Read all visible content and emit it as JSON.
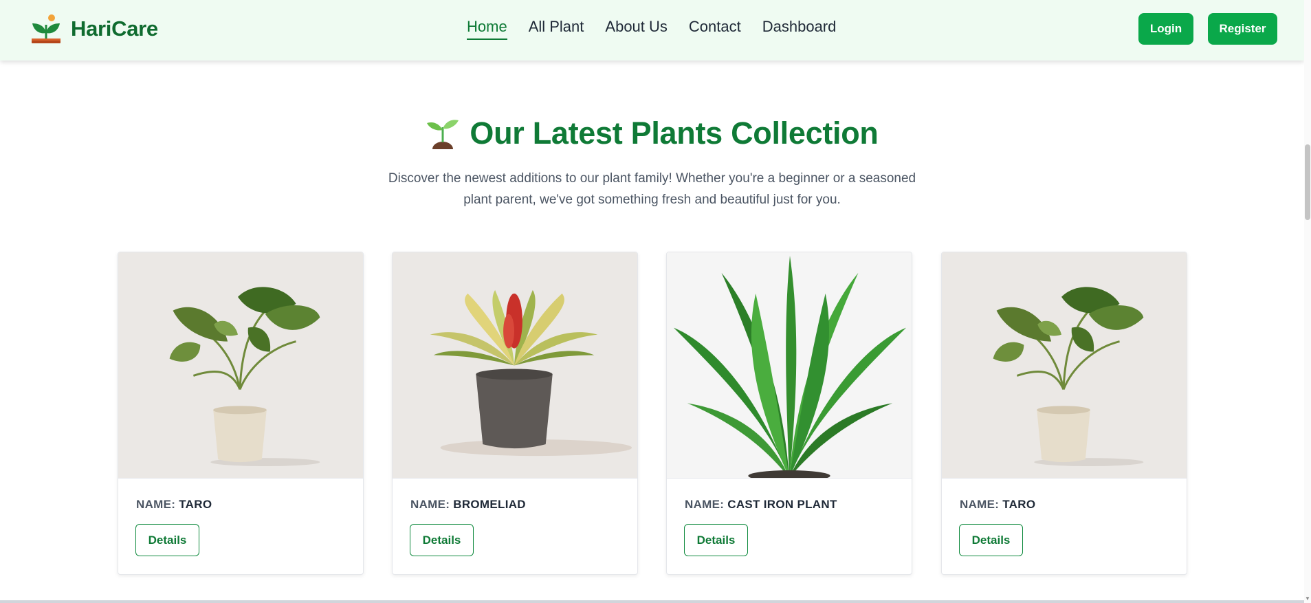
{
  "brand": {
    "name": "HariCare",
    "logo_icon": "plant-sprout-icon"
  },
  "nav": {
    "items": [
      {
        "label": "Home",
        "active": true
      },
      {
        "label": "All Plant",
        "active": false
      },
      {
        "label": "About Us",
        "active": false
      },
      {
        "label": "Contact",
        "active": false
      },
      {
        "label": "Dashboard",
        "active": false
      }
    ],
    "login_label": "Login",
    "register_label": "Register"
  },
  "section": {
    "title_icon": "seedling-icon",
    "title": "Our Latest Plants Collection",
    "description": "Discover the newest additions to our plant family! Whether you're a beginner or a seasoned plant parent, we've got something fresh and beautiful just for you."
  },
  "cards": [
    {
      "name_label": "NAME:",
      "name": "TARO",
      "button": "Details",
      "image": "taro-plant-image"
    },
    {
      "name_label": "NAME:",
      "name": "BROMELIAD",
      "button": "Details",
      "image": "bromeliad-plant-image"
    },
    {
      "name_label": "NAME:",
      "name": "CAST IRON PLANT",
      "button": "Details",
      "image": "cast-iron-plant-image"
    },
    {
      "name_label": "NAME:",
      "name": "TARO",
      "button": "Details",
      "image": "taro-plant-image"
    }
  ],
  "colors": {
    "brand_green": "#0f7a36",
    "button_green": "#0aa84a",
    "navbar_bg": "#effbf2"
  }
}
